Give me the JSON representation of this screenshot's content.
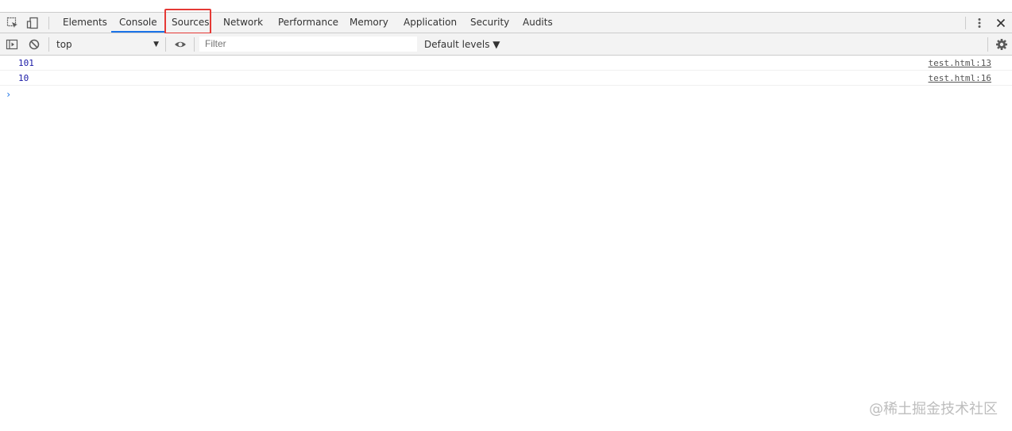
{
  "devtools": {
    "tabs": [
      {
        "label": "Elements"
      },
      {
        "label": "Console"
      },
      {
        "label": "Sources"
      },
      {
        "label": "Network"
      },
      {
        "label": "Performance"
      },
      {
        "label": "Memory"
      },
      {
        "label": "Application"
      },
      {
        "label": "Security"
      },
      {
        "label": "Audits"
      }
    ],
    "active_tab": "Console",
    "highlighted_tab": "Sources",
    "highlight_color": "#e53935",
    "accent_color": "#1a73e8",
    "icons": {
      "inspect": "inspect-element-icon",
      "device": "device-toolbar-icon",
      "more": "more-vertical-icon",
      "close": "close-icon",
      "sidebar": "console-sidebar-icon",
      "clear": "clear-console-icon",
      "eye": "live-expression-icon",
      "settings": "gear-icon"
    }
  },
  "toolbar": {
    "context": "top",
    "filter_placeholder": "Filter",
    "levels": "Default levels ▼"
  },
  "console": {
    "messages": [
      {
        "value": "101",
        "source": "test.html:13"
      },
      {
        "value": "10",
        "source": "test.html:16"
      }
    ],
    "prompt": "›"
  },
  "watermark": "@稀土掘金技术社区"
}
